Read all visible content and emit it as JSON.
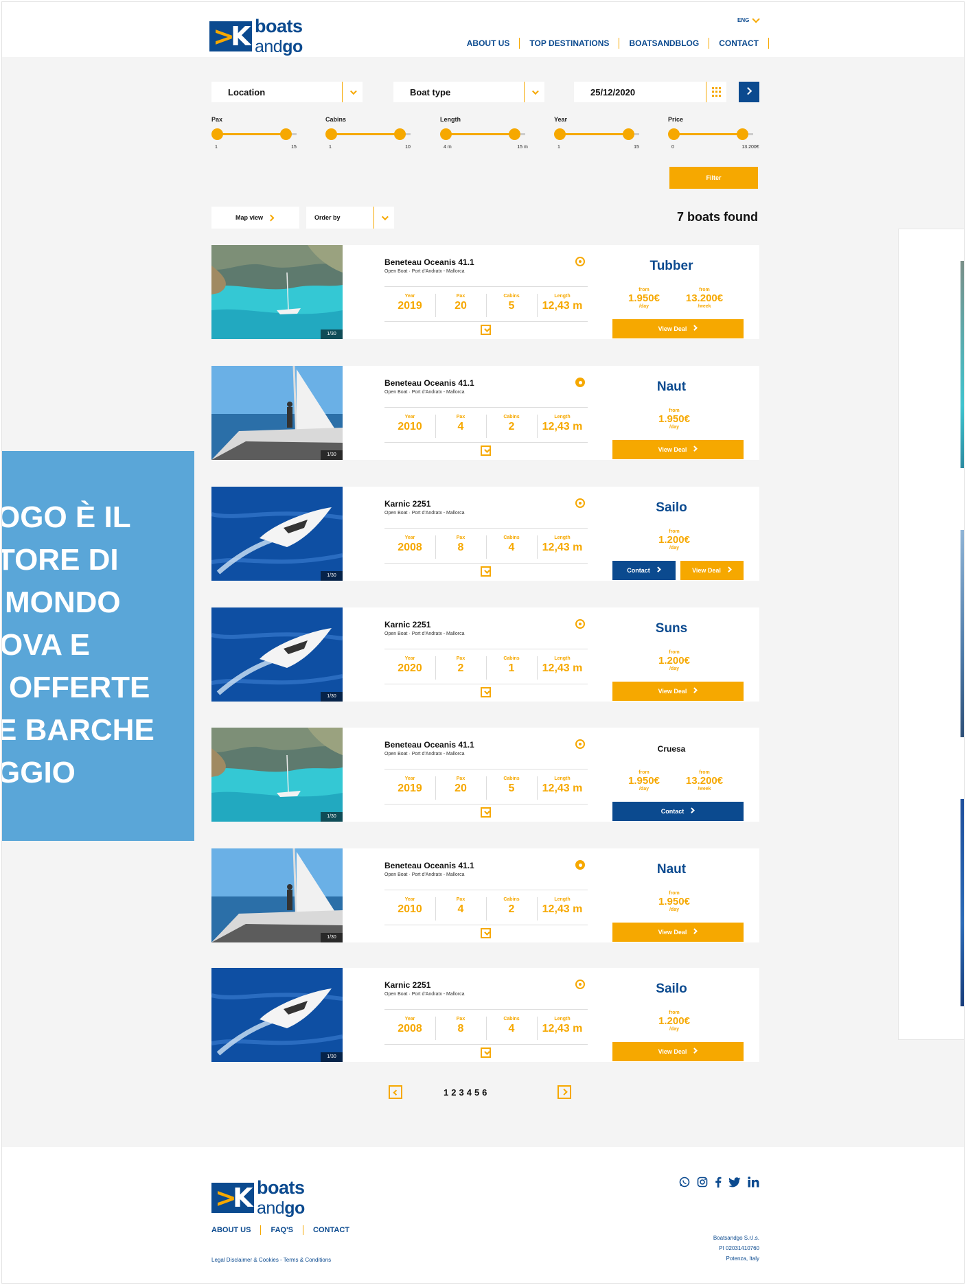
{
  "header": {
    "logo": {
      "word1": "boats",
      "word2a": "and",
      "word2b": "go"
    },
    "language": "ENG",
    "nav": [
      "ABOUT US",
      "TOP DESTINATIONS",
      "BOATSANDBLOG",
      "CONTACT"
    ]
  },
  "search": {
    "location_label": "Location",
    "boat_type_label": "Boat type",
    "date_value": "25/12/2020"
  },
  "filters": [
    {
      "name": "Pax",
      "min": "1",
      "max": "15",
      "low": 1,
      "high": 15
    },
    {
      "name": "Cabins",
      "min": "1",
      "max": "10",
      "low": 1,
      "high": 10
    },
    {
      "name": "Length",
      "min": "4 m",
      "max": "15 m",
      "low": 4,
      "high": 15
    },
    {
      "name": "Year",
      "min": "1",
      "max": "15",
      "low": 1,
      "high": 15
    },
    {
      "name": "Price",
      "min": "0",
      "max": "13.200€",
      "low": 0,
      "high": 13200
    }
  ],
  "filter_button": "Filter",
  "results": {
    "map_view": "Map view",
    "order_by": "Order by",
    "count_text": "7 boats found"
  },
  "spec_labels": {
    "year": "Year",
    "pax": "Pax",
    "cabins": "Cabins",
    "length": "Length"
  },
  "boats": [
    {
      "title": "Beneteau Oceanis 41.1",
      "subtitle": "Open Boat · Port d'Andratx - Mallorca",
      "year": "2019",
      "pax": "20",
      "cabins": "5",
      "length": "12,43 m",
      "photo_counter": "1/30",
      "favorite": false,
      "brand": "Tubber",
      "prices": [
        {
          "from": "from",
          "price": "1.950€",
          "unit": "/day"
        },
        {
          "from": "from",
          "price": "13.200€",
          "unit": "/week"
        }
      ],
      "buttons": [
        {
          "kind": "deal",
          "label": "View Deal"
        }
      ]
    },
    {
      "title": "Beneteau Oceanis 41.1",
      "subtitle": "Open Boat · Port d'Andratx - Mallorca",
      "year": "2010",
      "pax": "4",
      "cabins": "2",
      "length": "12,43 m",
      "photo_counter": "1/30",
      "favorite": true,
      "brand": "Naut",
      "prices": [
        {
          "from": "from",
          "price": "1.950€",
          "unit": "/day"
        }
      ],
      "buttons": [
        {
          "kind": "deal",
          "label": "View Deal"
        }
      ]
    },
    {
      "title": "Karnic 2251",
      "subtitle": "Open Boat · Port d'Andratx - Mallorca",
      "year": "2008",
      "pax": "8",
      "cabins": "4",
      "length": "12,43 m",
      "photo_counter": "1/30",
      "favorite": false,
      "brand": "Sailo",
      "prices": [
        {
          "from": "from",
          "price": "1.200€",
          "unit": "/day"
        }
      ],
      "buttons": [
        {
          "kind": "contact",
          "label": "Contact"
        },
        {
          "kind": "deal",
          "label": "View Deal"
        }
      ]
    },
    {
      "title": "Karnic 2251",
      "subtitle": "Open Boat · Port d'Andratx - Mallorca",
      "year": "2020",
      "pax": "2",
      "cabins": "1",
      "length": "12,43 m",
      "photo_counter": "1/30",
      "favorite": false,
      "brand": "Suns",
      "prices": [
        {
          "from": "from",
          "price": "1.200€",
          "unit": "/day"
        }
      ],
      "buttons": [
        {
          "kind": "deal",
          "label": "View Deal"
        }
      ]
    },
    {
      "title": "Beneteau Oceanis 41.1",
      "subtitle": "Open Boat · Port d'Andratx - Mallorca",
      "year": "2019",
      "pax": "20",
      "cabins": "5",
      "length": "12,43 m",
      "photo_counter": "1/30",
      "favorite": false,
      "brand": "Cruesa",
      "prices": [
        {
          "from": "from",
          "price": "1.950€",
          "unit": "/day"
        },
        {
          "from": "from",
          "price": "13.200€",
          "unit": "/week"
        }
      ],
      "buttons": [
        {
          "kind": "contact",
          "label": "Contact"
        }
      ]
    },
    {
      "title": "Beneteau Oceanis 41.1",
      "subtitle": "Open Boat · Port d'Andratx - Mallorca",
      "year": "2010",
      "pax": "4",
      "cabins": "2",
      "length": "12,43 m",
      "photo_counter": "1/30",
      "favorite": true,
      "brand": "Naut",
      "prices": [
        {
          "from": "from",
          "price": "1.950€",
          "unit": "/day"
        }
      ],
      "buttons": [
        {
          "kind": "deal",
          "label": "View Deal"
        }
      ]
    },
    {
      "title": "Karnic 2251",
      "subtitle": "Open Boat · Port d'Andratx - Mallorca",
      "year": "2008",
      "pax": "8",
      "cabins": "4",
      "length": "12,43 m",
      "photo_counter": "1/30",
      "favorite": false,
      "brand": "Sailo",
      "prices": [
        {
          "from": "from",
          "price": "1.200€",
          "unit": "/day"
        }
      ],
      "buttons": [
        {
          "kind": "deal",
          "label": "View Deal"
        }
      ]
    }
  ],
  "pagination": {
    "pages": [
      "1",
      "2",
      "3",
      "4",
      "5",
      "6"
    ]
  },
  "promo_lines": [
    "OGO È IL",
    "TORE DI",
    "MONDO",
    "OVA E",
    "OFFERTE",
    "E BARCHE",
    "GGIO"
  ],
  "footer": {
    "nav": [
      "ABOUT US",
      "FAQ'S",
      "CONTACT"
    ],
    "legal": "Legal Disclaimer & Cookies - Terms & Conditions",
    "company": [
      "Boatsandgo S.r.l.s.",
      "PI 02031410760",
      "Potenza, Italy"
    ],
    "social": [
      "whatsapp-icon",
      "instagram-icon",
      "facebook-icon",
      "twitter-icon",
      "linkedin-icon"
    ]
  },
  "colors": {
    "brand_blue": "#0b4a8f",
    "accent_orange": "#f6a800",
    "page_bg": "#f4f4f4",
    "promo_blue": "#5aa6d8"
  }
}
